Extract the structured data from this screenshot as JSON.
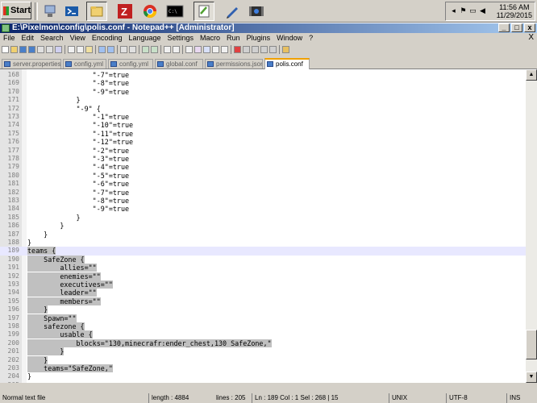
{
  "taskbar": {
    "start_label": "Start",
    "tray": {
      "time": "11:56 AM",
      "date": "11/29/2015"
    },
    "icons": [
      "network-icon",
      "powershell-icon",
      "explorer-icon",
      "filezilla-icon",
      "chrome-icon",
      "cmd-icon",
      "notepadpp-icon",
      "pencil-icon",
      "media-icon"
    ]
  },
  "window": {
    "title": "E:\\Pixelmon\\config\\polis.conf - Notepad++ [Administrator]",
    "min_label": "_",
    "max_label": "□",
    "close_label": "x"
  },
  "menu": {
    "items": [
      "File",
      "Edit",
      "Search",
      "View",
      "Encoding",
      "Language",
      "Settings",
      "Macro",
      "Run",
      "Plugins",
      "Window",
      "?"
    ],
    "close_glyph": "X"
  },
  "tabs": [
    {
      "label": "server.properties",
      "active": false
    },
    {
      "label": "config.yml",
      "active": false
    },
    {
      "label": "config.yml",
      "active": false
    },
    {
      "label": "global.conf",
      "active": false
    },
    {
      "label": "permissions.json",
      "active": false
    },
    {
      "label": "polis.conf",
      "active": true
    }
  ],
  "editor": {
    "caret_line": 189,
    "lines": [
      {
        "n": "168",
        "pre": "                \"-7\"=true",
        "sel": "",
        "post": ""
      },
      {
        "n": "169",
        "pre": "                \"-8\"=true",
        "sel": "",
        "post": ""
      },
      {
        "n": "170",
        "pre": "                \"-9\"=true",
        "sel": "",
        "post": ""
      },
      {
        "n": "171",
        "pre": "            }",
        "sel": "",
        "post": ""
      },
      {
        "n": "172",
        "pre": "            \"-9\" {",
        "sel": "",
        "post": ""
      },
      {
        "n": "173",
        "pre": "                \"-1\"=true",
        "sel": "",
        "post": ""
      },
      {
        "n": "174",
        "pre": "                \"-10\"=true",
        "sel": "",
        "post": ""
      },
      {
        "n": "175",
        "pre": "                \"-11\"=true",
        "sel": "",
        "post": ""
      },
      {
        "n": "176",
        "pre": "                \"-12\"=true",
        "sel": "",
        "post": ""
      },
      {
        "n": "177",
        "pre": "                \"-2\"=true",
        "sel": "",
        "post": ""
      },
      {
        "n": "178",
        "pre": "                \"-3\"=true",
        "sel": "",
        "post": ""
      },
      {
        "n": "179",
        "pre": "                \"-4\"=true",
        "sel": "",
        "post": ""
      },
      {
        "n": "180",
        "pre": "                \"-5\"=true",
        "sel": "",
        "post": ""
      },
      {
        "n": "181",
        "pre": "                \"-6\"=true",
        "sel": "",
        "post": ""
      },
      {
        "n": "182",
        "pre": "                \"-7\"=true",
        "sel": "",
        "post": ""
      },
      {
        "n": "183",
        "pre": "                \"-8\"=true",
        "sel": "",
        "post": ""
      },
      {
        "n": "184",
        "pre": "                \"-9\"=true",
        "sel": "",
        "post": ""
      },
      {
        "n": "185",
        "pre": "            }",
        "sel": "",
        "post": ""
      },
      {
        "n": "186",
        "pre": "        }",
        "sel": "",
        "post": ""
      },
      {
        "n": "187",
        "pre": "    }",
        "sel": "",
        "post": ""
      },
      {
        "n": "188",
        "pre": "}",
        "sel": "",
        "post": ""
      },
      {
        "n": "189",
        "pre": "",
        "sel": "teams {",
        "post": ""
      },
      {
        "n": "190",
        "pre": "",
        "sel": "    SafeZone {",
        "post": ""
      },
      {
        "n": "191",
        "pre": "",
        "sel": "        allies=\"\"",
        "post": ""
      },
      {
        "n": "192",
        "pre": "",
        "sel": "        enemies=\"\"",
        "post": ""
      },
      {
        "n": "193",
        "pre": "",
        "sel": "        executives=\"\"",
        "post": ""
      },
      {
        "n": "194",
        "pre": "",
        "sel": "        leader=\"\"",
        "post": ""
      },
      {
        "n": "195",
        "pre": "",
        "sel": "        members=\"\"",
        "post": ""
      },
      {
        "n": "196",
        "pre": "",
        "sel": "    }",
        "post": ""
      },
      {
        "n": "197",
        "pre": "",
        "sel": "    Spawn=\"\"",
        "post": ""
      },
      {
        "n": "198",
        "pre": "",
        "sel": "    safezone {",
        "post": ""
      },
      {
        "n": "199",
        "pre": "",
        "sel": "        usable {",
        "post": ""
      },
      {
        "n": "200",
        "pre": "",
        "sel": "            blocks=\"130,minecrafr:ender_chest,130 SafeZone,\"",
        "post": ""
      },
      {
        "n": "201",
        "pre": "",
        "sel": "        }",
        "post": ""
      },
      {
        "n": "202",
        "pre": "",
        "sel": "    }",
        "post": ""
      },
      {
        "n": "203",
        "pre": "",
        "sel": "    teams=\"SafeZone,\"",
        "post": ""
      },
      {
        "n": "204",
        "pre": "}",
        "sel": "",
        "post": ""
      },
      {
        "n": "205",
        "pre": "",
        "sel": "",
        "post": ""
      }
    ]
  },
  "status": {
    "file_type": "Normal text file",
    "length": "length : 4884",
    "lines": "lines : 205",
    "position": "Ln : 189    Col : 1    Sel : 268 | 15",
    "eol": "UNIX",
    "encoding": "UTF-8",
    "mode": "INS"
  },
  "colors": {
    "title_gradient_start": "#0a246a",
    "title_gradient_end": "#a6caf0",
    "selection": "#c0c0c0",
    "active_tab_accent": "#f0a000"
  }
}
